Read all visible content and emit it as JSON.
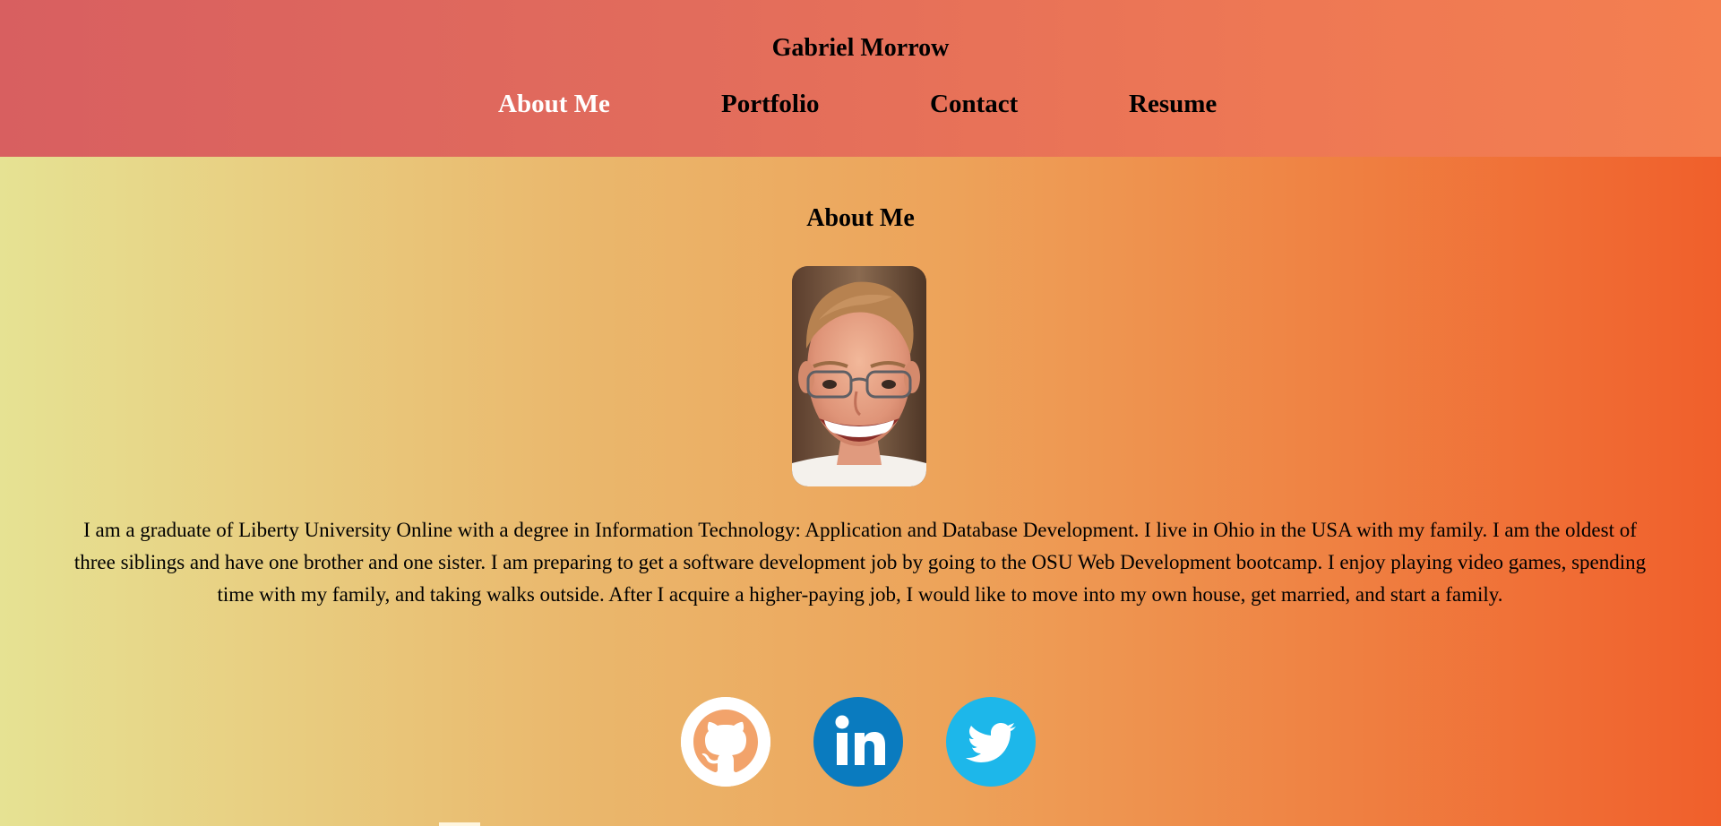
{
  "header": {
    "site_title": "Gabriel Morrow",
    "nav": [
      {
        "label": "About Me",
        "active": true
      },
      {
        "label": "Portfolio",
        "active": false
      },
      {
        "label": "Contact",
        "active": false
      },
      {
        "label": "Resume",
        "active": false
      }
    ]
  },
  "about": {
    "title": "About Me",
    "photo_icon": "profile-photo",
    "bio": "I am a graduate of Liberty University Online with a degree in Information Technology: Application and Database Development. I live in Ohio in the USA with my family. I am the oldest of three siblings and have one brother and one sister. I am preparing to get a software development job by going to the OSU Web Development bootcamp. I enjoy playing video games, spending time with my family, and taking walks outside. After I acquire a higher-paying job, I would like to move into my own house, get married, and start a family."
  },
  "social": [
    {
      "icon": "github-icon",
      "color": "#ffffff"
    },
    {
      "icon": "linkedin-icon",
      "color": "#0a7bbf"
    },
    {
      "icon": "twitter-icon",
      "color": "#1db7ea"
    }
  ],
  "colors": {
    "header_start": "#d85f60",
    "header_end": "#f47f50",
    "body_start": "#e6e293",
    "body_end": "#f05f2b",
    "active_nav": "#ffffff"
  }
}
